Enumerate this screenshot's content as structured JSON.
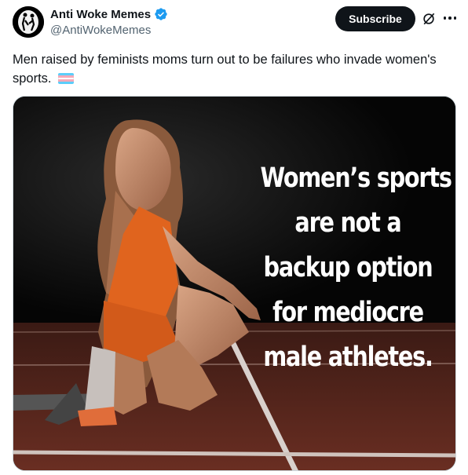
{
  "author": {
    "display_name": "Anti Woke Memes",
    "handle": "@AntiWokeMemes",
    "verified": true,
    "verified_color": "#1d9bf0"
  },
  "actions": {
    "subscribe_label": "Subscribe",
    "grok_icon": "grok-icon",
    "more_icon": "more-horizontal-icon"
  },
  "tweet": {
    "text": "Men raised by feminists moms turn out to be failures who invade women's sports.",
    "emoji": "transgender-flag"
  },
  "media": {
    "overlay_lines": [
      "Women’s sports",
      "are not a",
      "backup option",
      "for mediocre",
      "male athletes."
    ]
  }
}
